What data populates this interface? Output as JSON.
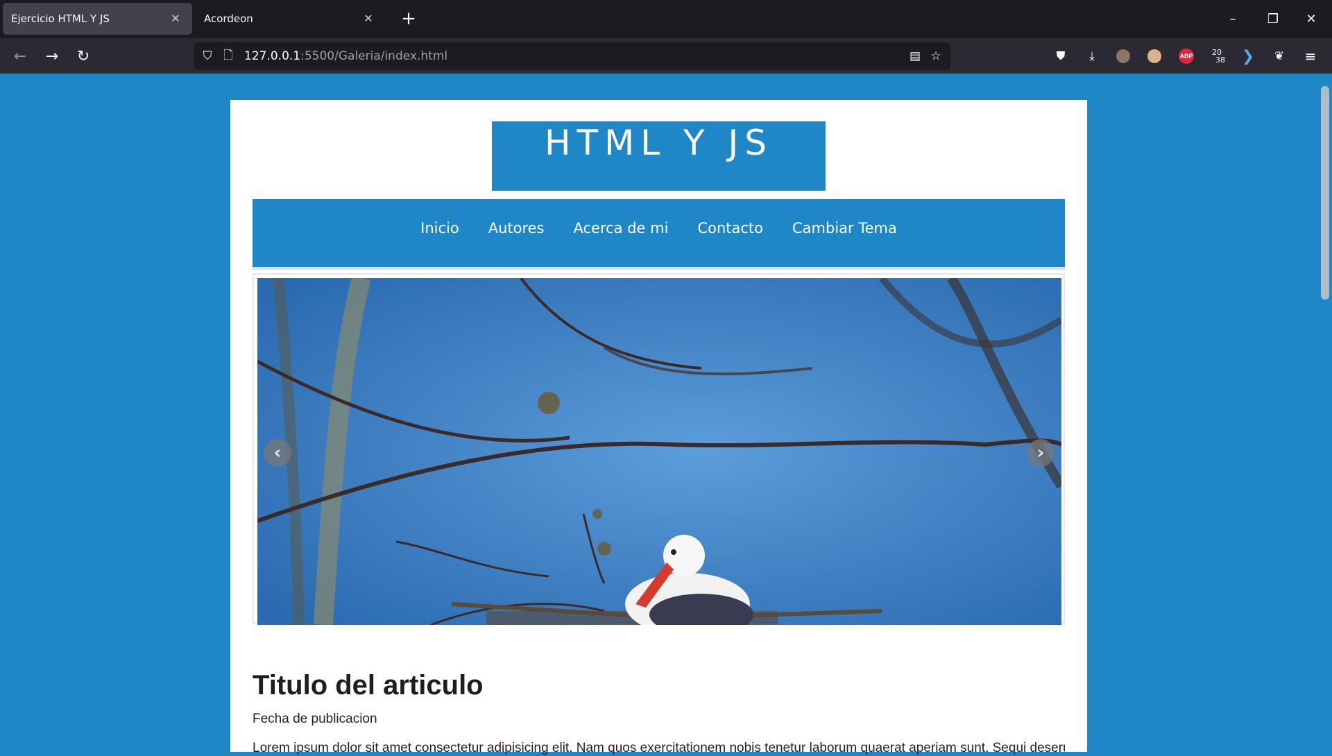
{
  "browser": {
    "tabs": [
      {
        "title": "Ejercicio HTML Y JS",
        "active": true
      },
      {
        "title": "Acordeon",
        "active": false
      }
    ],
    "url_host": "127.0.0.1",
    "url_path": ":5500/Galeria/index.html",
    "icons": [
      "back-icon",
      "forward-icon",
      "reload-icon",
      "shield-icon",
      "page-icon",
      "reader-view-icon",
      "bookmark-star-icon",
      "pocket-icon",
      "download-icon",
      "account-icon",
      "extension-icon",
      "adblock-icon",
      "extension-20-38-icon",
      "extension-arrow-icon",
      "extension-bird-icon",
      "menu-icon"
    ],
    "adblock_label": "ABP",
    "ext_label_top": "20",
    "ext_label_bottom": "38"
  },
  "site": {
    "logo": "HTML Y JS",
    "menu": [
      "Inicio",
      "Autores",
      "Acerca de mi",
      "Contacto",
      "Cambiar Tema"
    ],
    "carousel": {
      "prev": "‹",
      "next": "›"
    },
    "article": {
      "title": "Titulo del articulo",
      "date": "Fecha de publicacion",
      "body": "Lorem ipsum dolor sit amet consectetur adipisicing elit. Nam quos exercitationem nobis tenetur laborum quaerat aperiam sunt. Sequi deserunt"
    }
  },
  "colors": {
    "page_bg": "#1f87c6",
    "chrome_dark": "#1c1b22",
    "chrome_toolbar": "#2b2a33"
  }
}
